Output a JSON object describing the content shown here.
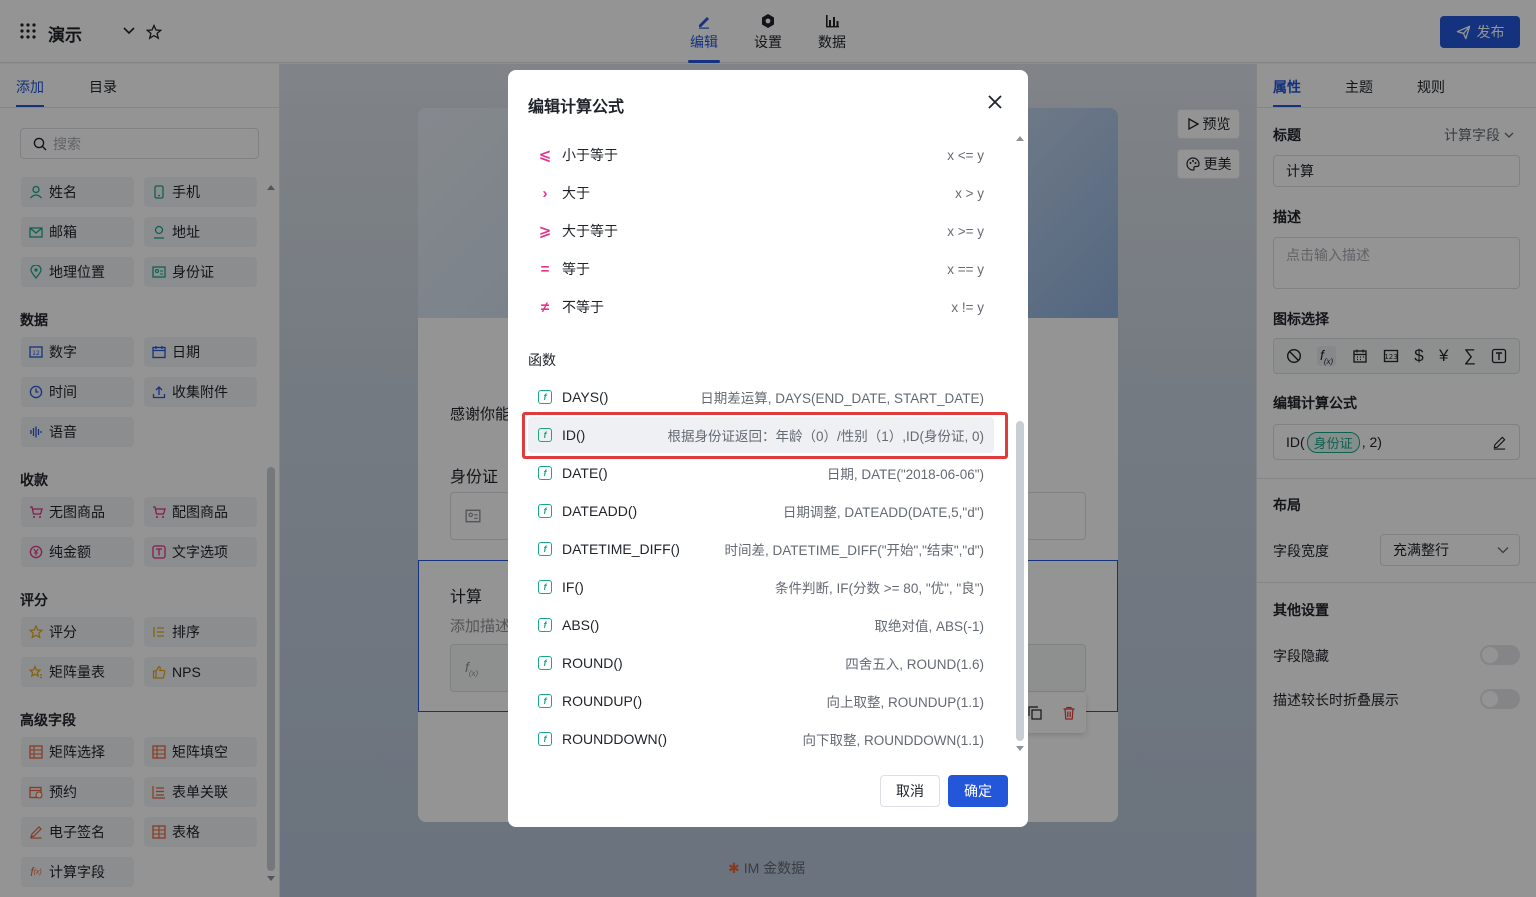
{
  "header": {
    "app_title": "演示",
    "tabs": [
      {
        "label": "编辑",
        "active": true
      },
      {
        "label": "设置",
        "active": false
      },
      {
        "label": "数据",
        "active": false
      }
    ],
    "publish_label": "发布"
  },
  "left": {
    "tabs": [
      "添加",
      "目录"
    ],
    "search_placeholder": "搜索",
    "top_items": [
      "姓名",
      "手机",
      "邮箱",
      "地址",
      "地理位置",
      "身份证"
    ],
    "sections": [
      {
        "title": "数据",
        "items": [
          "数字",
          "日期",
          "时间",
          "收集附件",
          "语音"
        ]
      },
      {
        "title": "收款",
        "items": [
          "无图商品",
          "配图商品",
          "纯金额",
          "文字选项"
        ]
      },
      {
        "title": "评分",
        "items": [
          "评分",
          "排序",
          "矩阵量表",
          "NPS"
        ]
      },
      {
        "title": "高级字段",
        "items": [
          "矩阵选择",
          "矩阵填空",
          "预约",
          "表单关联",
          "电子签名",
          "表格",
          "计算字段"
        ]
      }
    ]
  },
  "canvas": {
    "thanks_text": "感谢你能",
    "id_label": "身份证",
    "calc_label": "计算",
    "calc_desc": "添加描述",
    "preview_label": "预览",
    "more_label": "更美",
    "footer_brand": "IM 金数据"
  },
  "right": {
    "tabs": [
      "属性",
      "主题",
      "规则"
    ],
    "title_label": "标题",
    "field_type": "计算字段",
    "title_value": "计算",
    "desc_label": "描述",
    "desc_placeholder": "点击输入描述",
    "icon_label": "图标选择",
    "formula_label": "编辑计算公式",
    "formula_prefix": "ID(",
    "formula_tag": "身份证",
    "formula_suffix": ", 2)",
    "layout_label": "布局",
    "width_label": "字段宽度",
    "width_value": "充满整行",
    "other_label": "其他设置",
    "hide_label": "字段隐藏",
    "fold_label": "描述较长时折叠展示"
  },
  "modal": {
    "title": "编辑计算公式",
    "operators": [
      {
        "symbol": "⩽",
        "name": "小于等于",
        "desc": "x <= y"
      },
      {
        "symbol": "›",
        "name": "大于",
        "desc": "x > y"
      },
      {
        "symbol": "⩾",
        "name": "大于等于",
        "desc": "x >= y"
      },
      {
        "symbol": "=",
        "name": "等于",
        "desc": "x == y"
      },
      {
        "symbol": "≠",
        "name": "不等于",
        "desc": "x != y"
      }
    ],
    "functions_title": "函数",
    "functions": [
      {
        "name": "DAYS()",
        "desc": "日期差运算, DAYS(END_DATE, START_DATE)"
      },
      {
        "name": "ID()",
        "desc": "根据身份证返回：年龄（0）/性别（1）,ID(身份证, 0)"
      },
      {
        "name": "DATE()",
        "desc": "日期, DATE(\"2018-06-06\")"
      },
      {
        "name": "DATEADD()",
        "desc": "日期调整, DATEADD(DATE,5,\"d\")"
      },
      {
        "name": "DATETIME_DIFF()",
        "desc": "时间差, DATETIME_DIFF(\"开始\",\"结束\",\"d\")"
      },
      {
        "name": "IF()",
        "desc": "条件判断, IF(分数 >= 80, \"优\", \"良\")"
      },
      {
        "name": "ABS()",
        "desc": "取绝对值, ABS(-1)"
      },
      {
        "name": "ROUND()",
        "desc": "四舍五入, ROUND(1.6)"
      },
      {
        "name": "ROUNDUP()",
        "desc": "向上取整, ROUNDUP(1.1)"
      },
      {
        "name": "ROUNDDOWN()",
        "desc": "向下取整, ROUNDDOWN(1.1)"
      }
    ],
    "cancel_label": "取消",
    "ok_label": "确定"
  },
  "colors": {
    "accent": "#2456d9",
    "highlight": "#e23b3b",
    "function_icon": "#19a78a",
    "operator_icon": "#e5338a"
  }
}
